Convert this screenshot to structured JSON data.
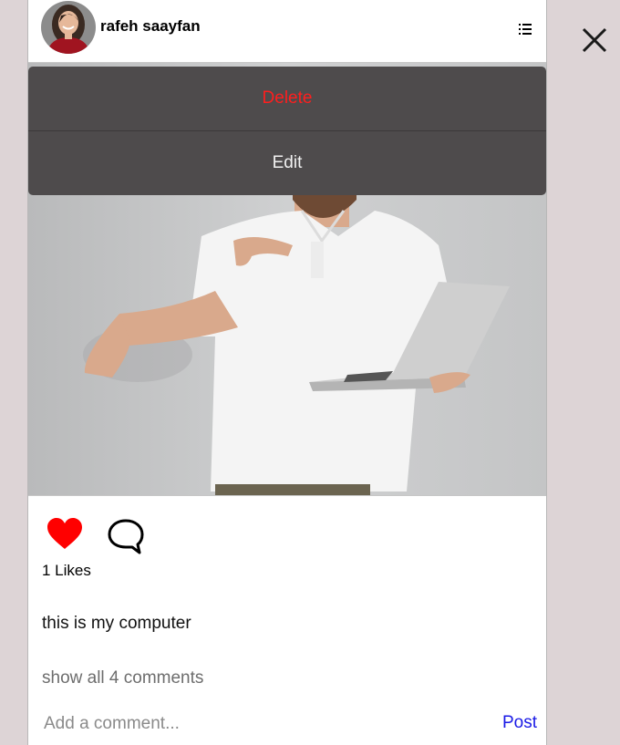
{
  "post": {
    "username": "rafeh saayfan",
    "likes_text": "1 Likes",
    "caption": "this is my computer",
    "show_comments": "show all 4 comments",
    "comment_placeholder": "Add a comment...",
    "post_label": "Post"
  },
  "options_menu": {
    "delete_label": "Delete",
    "edit_label": "Edit"
  },
  "icons": {
    "close": "close-icon",
    "menu": "list-icon",
    "like": "heart-icon",
    "comment": "speech-bubble-icon"
  },
  "colors": {
    "backdrop": "#ddd4d6",
    "menu_bg": "#4e4b4c",
    "delete": "#ff1e1e",
    "heart": "#ff0000",
    "post_link": "#1a1ae6"
  }
}
